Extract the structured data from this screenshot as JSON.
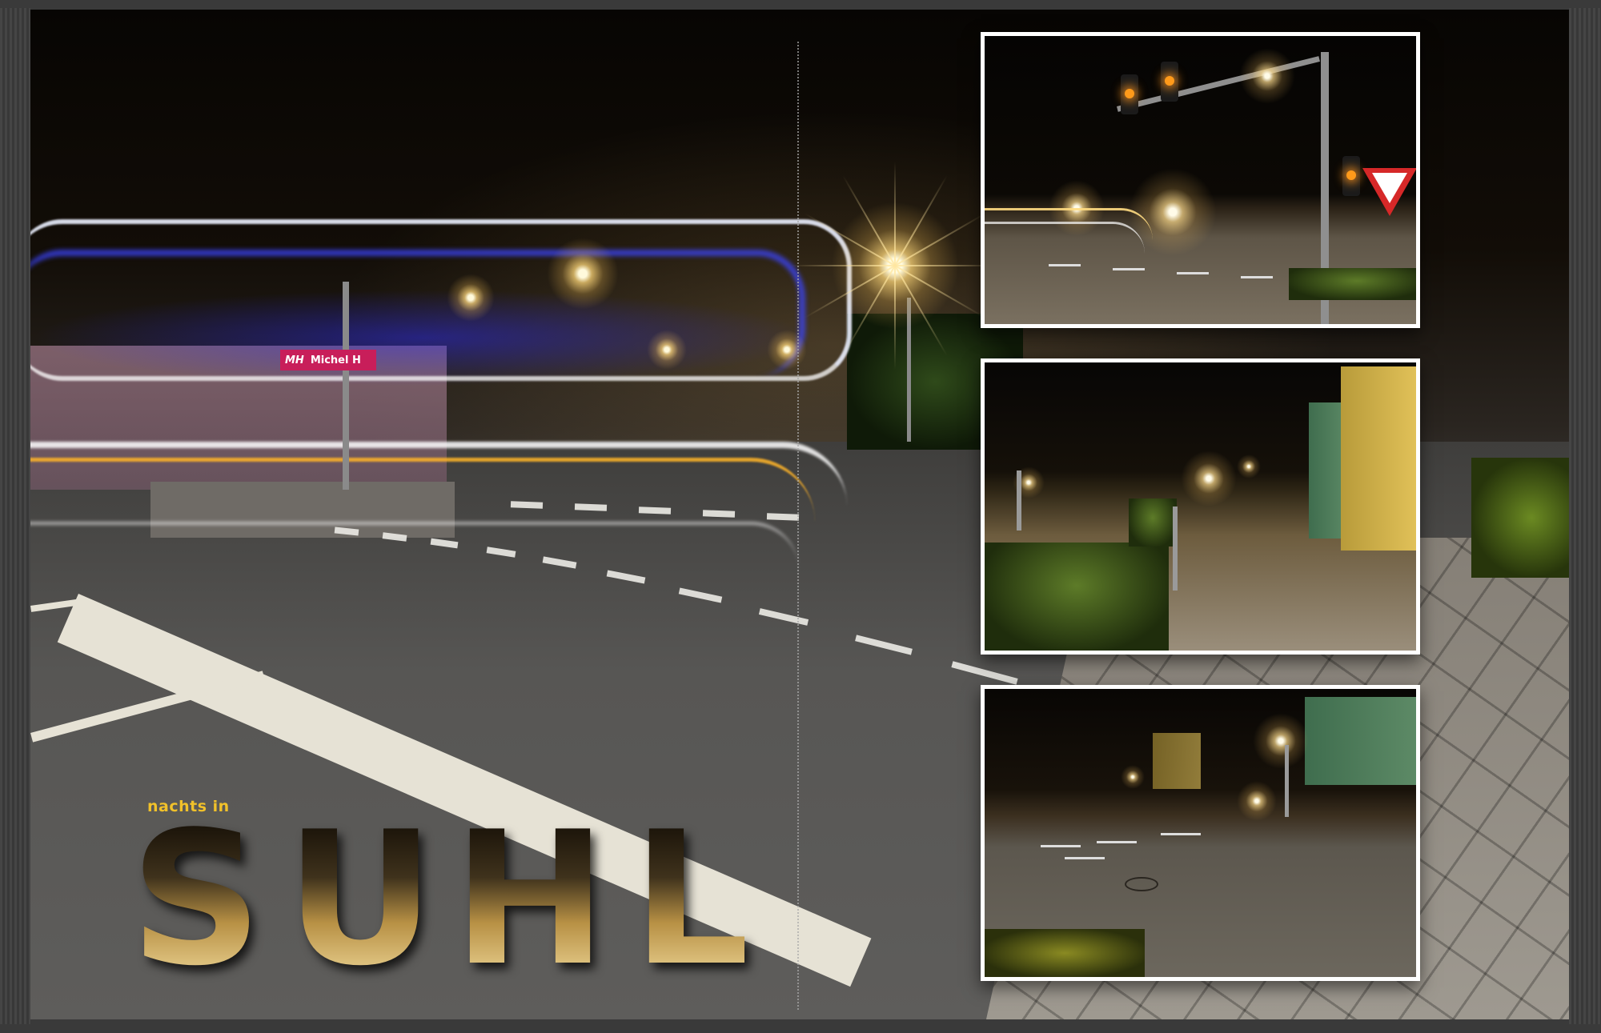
{
  "app": {
    "window_title": ""
  },
  "spread": {
    "kicker": "nachts in",
    "title_letters": [
      "S",
      "U",
      "H",
      "L"
    ],
    "billboard_text": "Michel H",
    "billboard_logo": "MH",
    "photos": [
      {
        "id": "photo-traffic-light-intersection"
      },
      {
        "id": "photo-sidewalk-street"
      },
      {
        "id": "photo-street-junction"
      }
    ]
  },
  "colors": {
    "frame": "#3a3a3a",
    "kicker": "#f1c12a",
    "photo_border": "#ffffff",
    "trail_blue": "#3c46ff",
    "trail_amber": "#ffb428"
  },
  "icons": [
    "starburst-light-icon",
    "traffic-light-icon",
    "yield-sign-icon"
  ]
}
